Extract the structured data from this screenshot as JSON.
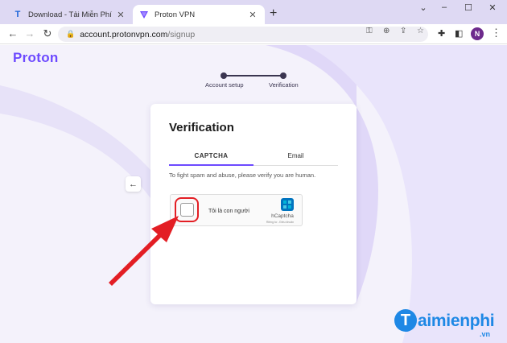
{
  "browser": {
    "tabs": [
      {
        "title": "Download - Tải Miễn Phí VN - Ph",
        "favicon": "T",
        "active": false
      },
      {
        "title": "Proton VPN",
        "active": true
      }
    ],
    "new_tab": "+",
    "window_controls": {
      "minimize": "–",
      "maximize": "☐",
      "close": "✕"
    },
    "url_host": "account.protonvpn.com",
    "url_path": "/signup",
    "profile_initial": "N"
  },
  "page": {
    "logo": "Proton",
    "stepper": {
      "steps": [
        {
          "label": "Account setup",
          "done": true
        },
        {
          "label": "Verification",
          "active": true
        }
      ]
    },
    "back_glyph": "←",
    "card": {
      "title": "Verification",
      "tabs": [
        "CAPTCHA",
        "Email"
      ],
      "selected_tab": "CAPTCHA",
      "hint": "To fight spam and abuse, please verify you are human.",
      "hcaptcha": {
        "label": "Tôi là con người",
        "brand": "hCaptcha",
        "legal": "Riêng tư - Điều khoản",
        "checked": false
      }
    },
    "watermark": {
      "text": "aimienphi",
      "initial": "T",
      "suffix": ".vn"
    }
  },
  "colors": {
    "accent": "#6d4aff",
    "annotation": "#e31e24",
    "tabstrip": "#ded9f3",
    "watermark": "#1e88e5"
  }
}
